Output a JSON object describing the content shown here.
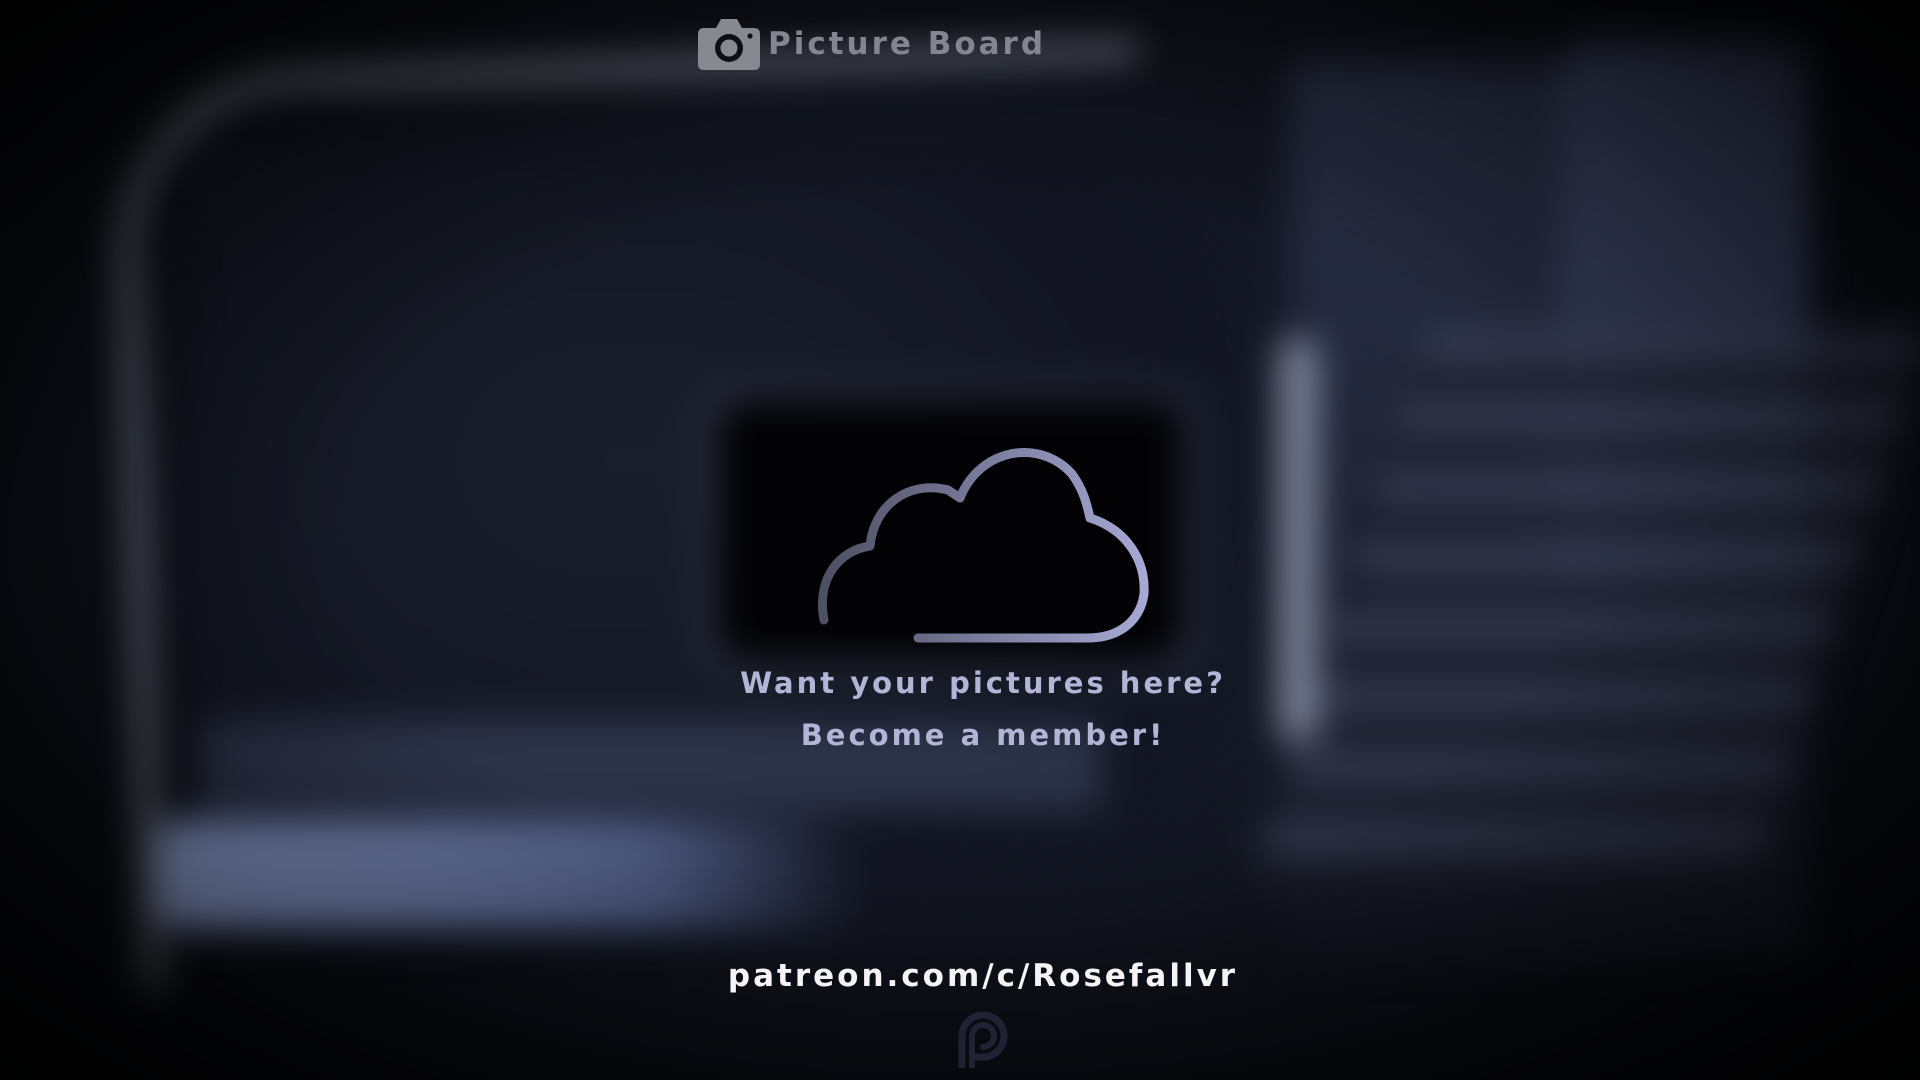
{
  "header": {
    "title": "Picture Board",
    "icon": "camera-icon"
  },
  "empty_state": {
    "icon": "cloud-icon",
    "line1": "Want your pictures here?",
    "line2": "Become a member!"
  },
  "footer": {
    "url": "patreon.com/c/Rosefallvr",
    "icon": "patreon-icon"
  },
  "colors": {
    "title_gray": "#84868f",
    "message_lavender": "#b3b5d6",
    "url_white": "#f4f4f6",
    "cloud_gradient_start": "#4d4f63",
    "cloud_gradient_end": "#a6a9d4",
    "patreon_icon": "#1e2233"
  }
}
